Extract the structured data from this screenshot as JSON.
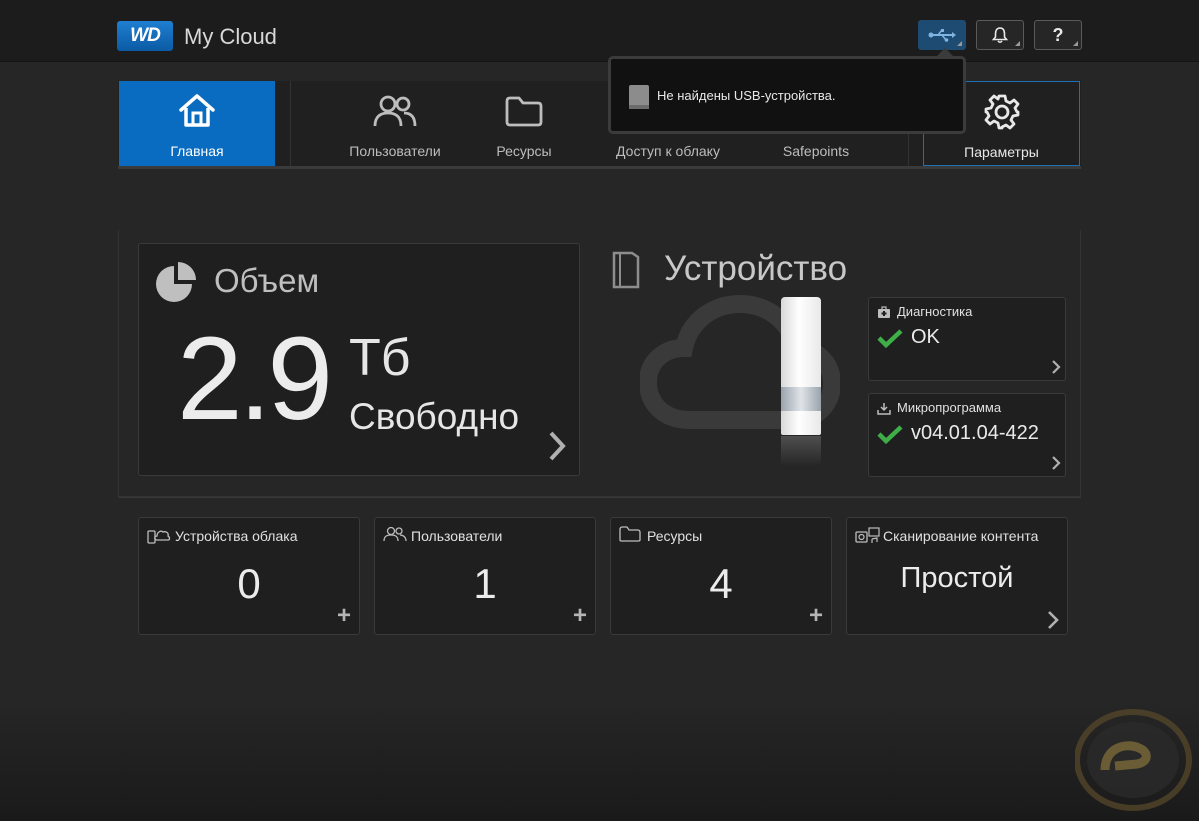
{
  "header": {
    "logo_badge": "WD",
    "app_title": "My Cloud",
    "usb_icon": "usb-icon",
    "bell_icon": "bell-icon",
    "help_label": "?"
  },
  "nav": {
    "items": [
      {
        "label": "Главная",
        "icon": "home-icon"
      },
      {
        "label": "Пользователи",
        "icon": "users-icon"
      },
      {
        "label": "Ресурсы",
        "icon": "folder-icon"
      },
      {
        "label": "Доступ к облаку",
        "icon": "cloud-access-icon"
      },
      {
        "label": "Safepoints",
        "icon": "safepoints-icon"
      },
      {
        "label": "Параметры",
        "icon": "gear-icon"
      }
    ]
  },
  "usb_popup": {
    "message": "Не найдены USB-устройства."
  },
  "capacity": {
    "title": "Объем",
    "value": "2.9",
    "unit": "Тб",
    "label": "Свободно"
  },
  "device": {
    "title": "Устройство",
    "diagnostics": {
      "title": "Диагностика",
      "value": "OK"
    },
    "firmware": {
      "title": "Микропрограмма",
      "value": "v04.01.04-422"
    }
  },
  "summary": [
    {
      "title": "Устройства облака",
      "value": "0",
      "icon": "cloud-devices-icon"
    },
    {
      "title": "Пользователи",
      "value": "1",
      "icon": "users-icon"
    },
    {
      "title": "Ресурсы",
      "value": "4",
      "icon": "folder-icon"
    },
    {
      "title": "Сканирование контента",
      "value": "Простой",
      "icon": "media-scan-icon"
    }
  ],
  "colors": {
    "accent": "#0a6cc0",
    "check": "#3fae49",
    "background": "#262626"
  }
}
